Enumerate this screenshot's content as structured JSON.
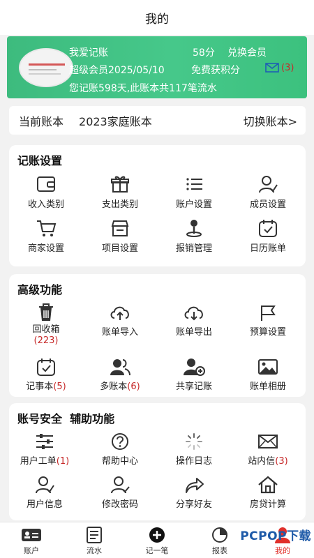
{
  "page_title": "我的",
  "hero": {
    "app_name": "我爱记账",
    "points": "58分",
    "redeem": "兑换会员",
    "member": "超级会员2025/05/10",
    "free_points": "免费获积分",
    "mail_count": "(3)",
    "summary": "您记账598天,此账本共117笔流水"
  },
  "book": {
    "label": "当前账本",
    "name": "2023家庭账本",
    "switch": "切换账本>"
  },
  "bookkeeping": {
    "title": "记账设置",
    "items": [
      "收入类别",
      "支出类别",
      "账户设置",
      "成员设置",
      "商家设置",
      "项目设置",
      "报销管理",
      "日历账单"
    ]
  },
  "advanced": {
    "title": "高级功能",
    "recycle": "回收箱",
    "recycle_count": "(223)",
    "import": "账单导入",
    "export": "账单导出",
    "budget": "预算设置",
    "notes": "记事本",
    "notes_count": "(5)",
    "multi": "多账本",
    "multi_count": "(6)",
    "share": "共享记账",
    "album": "账单相册"
  },
  "security": {
    "title": "账号安全",
    "title2": "辅助功能",
    "ticket": "用户工单",
    "ticket_count": "(1)",
    "help": "帮助中心",
    "log": "操作日志",
    "inbox": "站内信",
    "inbox_count": "(3)",
    "userinfo": "用户信息",
    "password": "修改密码",
    "share": "分享好友",
    "mortgage": "房贷计算"
  },
  "tabs": [
    "账户",
    "流水",
    "记一笔",
    "报表",
    "我的"
  ],
  "watermark": "PCPOP下载",
  "colors": {
    "hero": "#46c88a",
    "accent_red": "#e0302b",
    "count_red": "#c62828",
    "bg": "#f2f2f2"
  }
}
